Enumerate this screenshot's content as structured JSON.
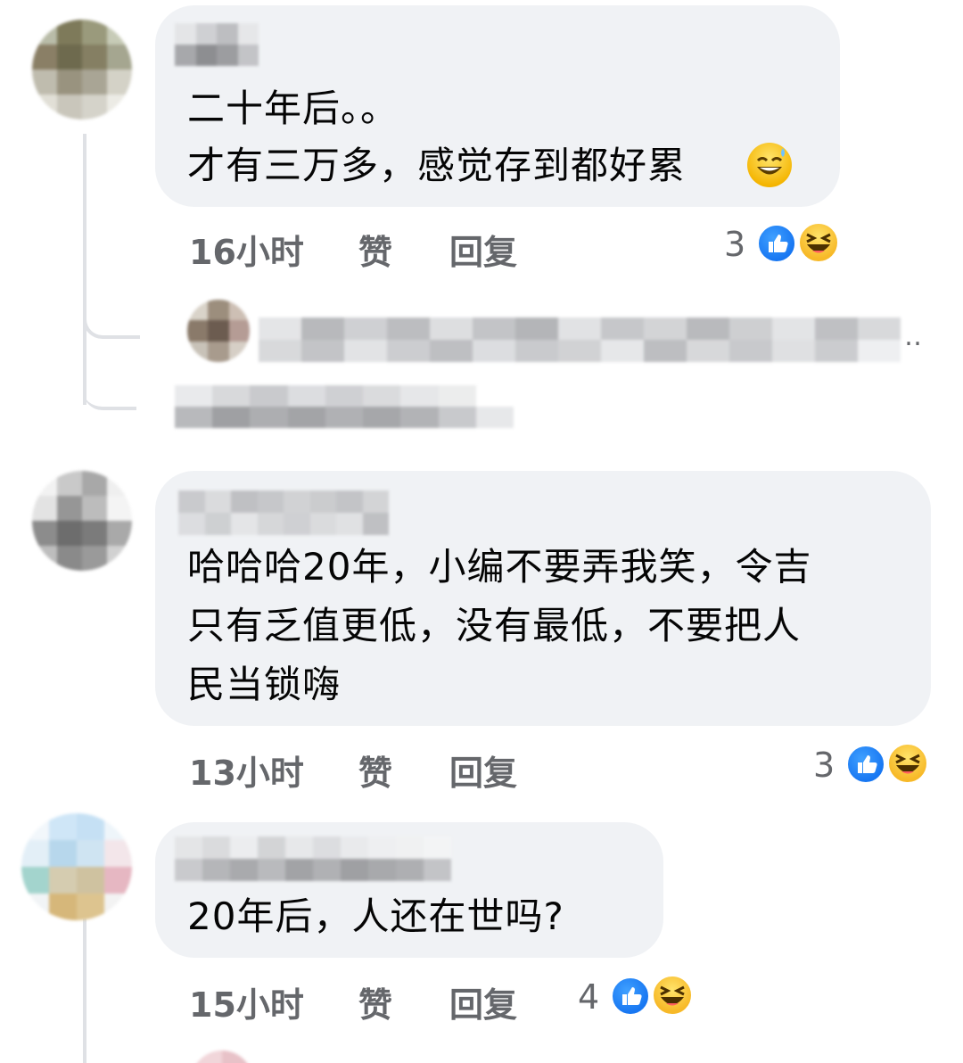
{
  "comments": [
    {
      "text_lines": [
        "二十年后。。",
        "才有三万多，感觉存到都好累"
      ],
      "time": "16小时",
      "like_label": "赞",
      "reply_label": "回复",
      "reaction_count": "3",
      "reactions": [
        "like-icon",
        "haha-icon"
      ],
      "inline_emoji": "grinning-sweat-icon"
    },
    {
      "text_lines": [
        "哈哈哈20年，小编不要弄我笑，令吉",
        "只有乏值更低，没有最低，不要把人",
        "民当锁嗨"
      ],
      "time": "13小时",
      "like_label": "赞",
      "reply_label": "回复",
      "reaction_count": "3",
      "reactions": [
        "like-icon",
        "haha-icon"
      ]
    },
    {
      "text_lines": [
        "20年后，人还在世吗?"
      ],
      "time": "15小时",
      "like_label": "赞",
      "reply_label": "回复",
      "reaction_count": "4",
      "reactions": [
        "like-icon",
        "haha-icon"
      ]
    }
  ],
  "reply_preview": {
    "trailing_text": "‥"
  },
  "colors": {
    "bubble": "#f0f2f5",
    "meta_text": "#65676b",
    "like_blue": "#1877f2",
    "haha_yellow": "#f7b928",
    "thread_line": "#dfe1e5"
  }
}
